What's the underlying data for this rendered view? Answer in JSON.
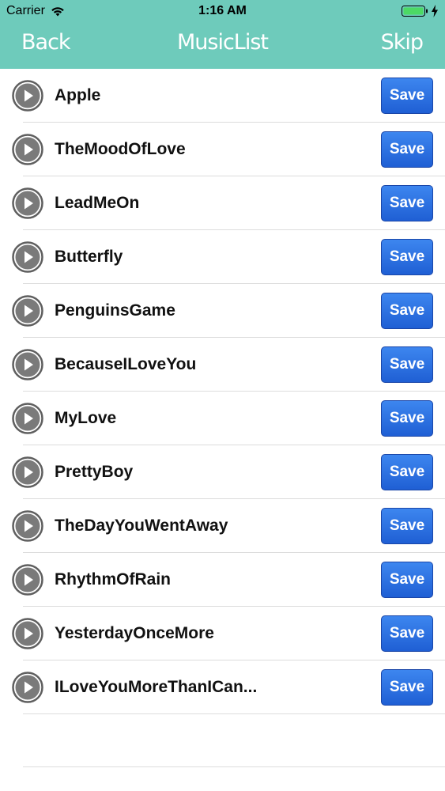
{
  "status_bar": {
    "carrier": "Carrier",
    "time": "1:16 AM",
    "wifi_icon": "wifi-icon",
    "battery_icon": "battery-full-icon",
    "charging_icon": "charging-bolt-icon",
    "battery_color": "#4cd964"
  },
  "nav": {
    "back_label": "Back",
    "title": "MusicList",
    "skip_label": "Skip",
    "background_color": "#6ecbbb"
  },
  "songs": [
    {
      "title": "Apple",
      "action_label": "Save"
    },
    {
      "title": "TheMoodOfLove",
      "action_label": "Save"
    },
    {
      "title": "LeadMeOn",
      "action_label": "Save"
    },
    {
      "title": "Butterfly",
      "action_label": "Save"
    },
    {
      "title": "PenguinsGame",
      "action_label": "Save"
    },
    {
      "title": "BecauseILoveYou",
      "action_label": "Save"
    },
    {
      "title": "MyLove",
      "action_label": "Save"
    },
    {
      "title": "PrettyBoy",
      "action_label": "Save"
    },
    {
      "title": "TheDayYouWentAway",
      "action_label": "Save"
    },
    {
      "title": "RhythmOfRain",
      "action_label": "Save"
    },
    {
      "title": "YesterdayOnceMore",
      "action_label": "Save"
    },
    {
      "title": "ILoveYouMoreThanICan...",
      "action_label": "Save"
    }
  ],
  "icons": {
    "play": "play-icon"
  },
  "colors": {
    "save_button": "#2a6fe0",
    "play_button": "#7a7a7a"
  }
}
